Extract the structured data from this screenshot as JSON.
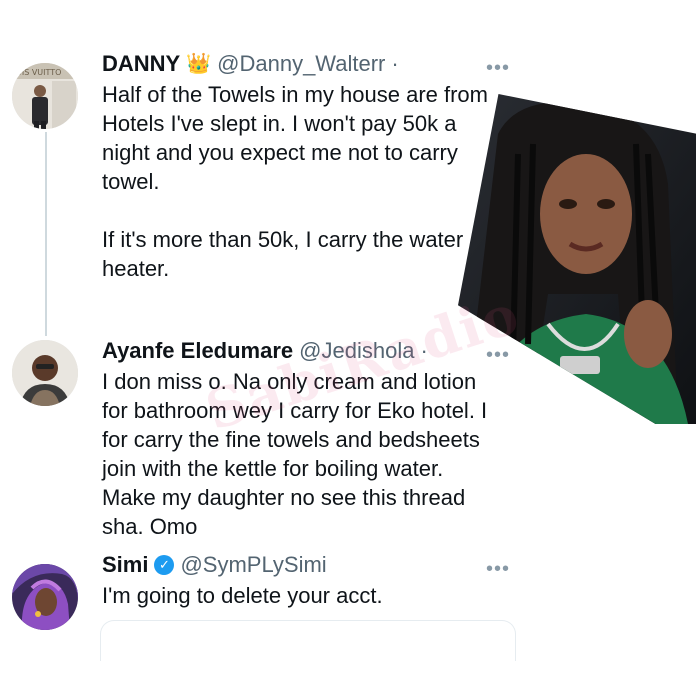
{
  "tweets": [
    {
      "name": "DANNY",
      "badge": "👑",
      "handle": "@Danny_Walterr",
      "dot": "·",
      "more": "•••",
      "text": "Half of the Towels in my house are from\nHotels I've slept in. I won't pay 50k a\nnight and you expect me not to carry\ntowel.\n\nIf it's more than 50k, I carry the water\nheater.",
      "avatar_icon": "person-avatar"
    },
    {
      "name": "Ayanfe Eledumare",
      "handle": "@Jedishola",
      "dot": "·",
      "more": "•••",
      "text": "I don miss o. Na only cream and lotion\nfor bathroom wey I carry for Eko hotel. I\nfor carry the fine towels and bedsheets\njoin with the kettle for boiling water.\nMake my daughter no see this thread\nsha. Omo",
      "avatar_icon": "person-avatar"
    },
    {
      "name": "Simi",
      "verified": "✓",
      "handle": "@SymPLySimi",
      "more": "•••",
      "text": "I'm going to delete your acct.",
      "avatar_icon": "illustrated-avatar"
    }
  ],
  "watermark": "SabiRadio",
  "colors": {
    "text": "#0f1419",
    "secondary": "#536471",
    "verified_blue": "#1d9bf0",
    "thread_line": "#cfd9de"
  }
}
